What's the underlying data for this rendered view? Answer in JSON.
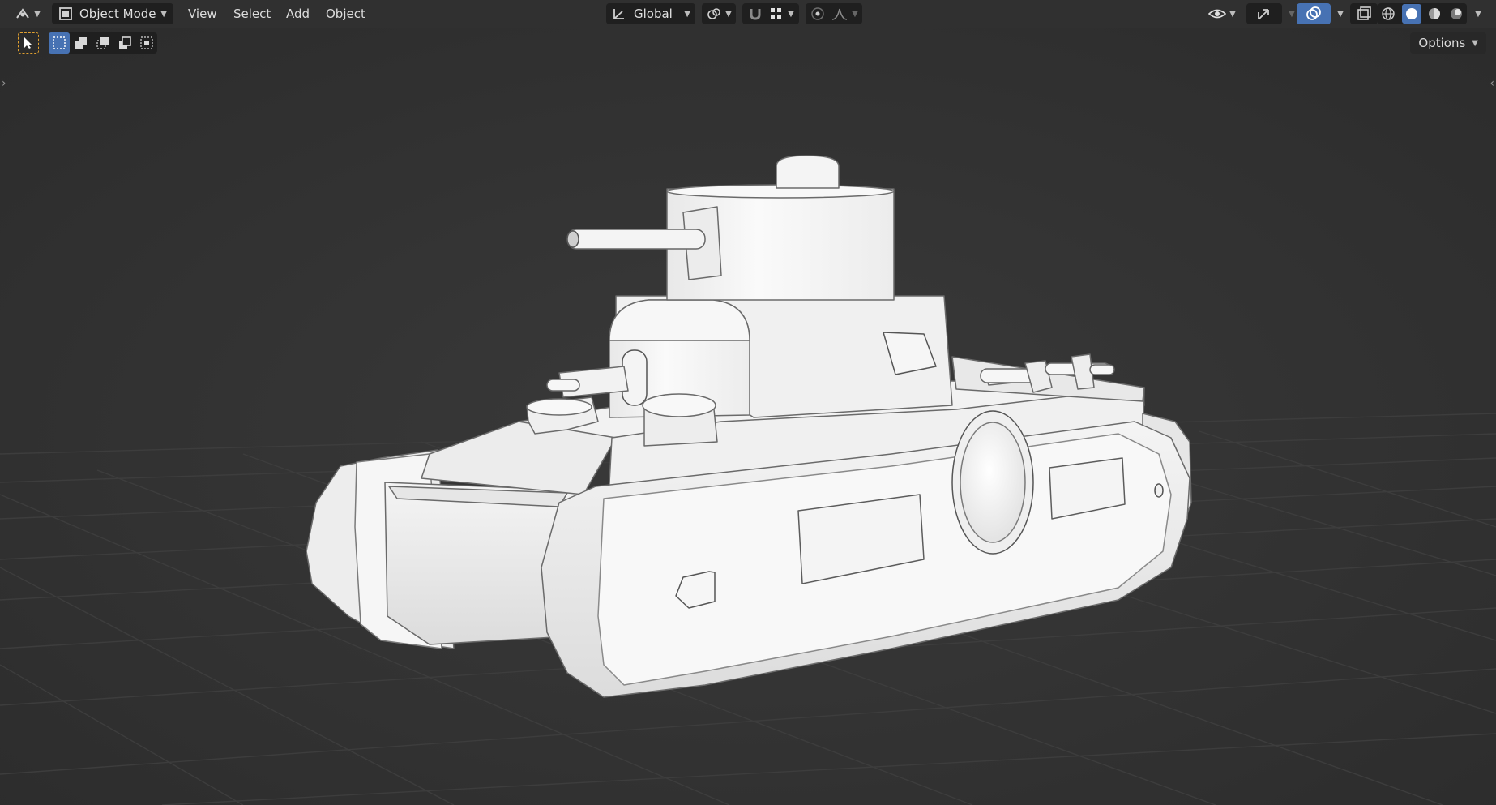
{
  "header": {
    "mode_label": "Object Mode",
    "menus": [
      "View",
      "Select",
      "Add",
      "Object"
    ],
    "transform_orientation": "Global"
  },
  "toolbar2": {
    "options_label": "Options"
  },
  "icons": {
    "editor_type": "editor-type-icon",
    "object_mode": "object-mode-icon",
    "orientation": "transform-orientation-icon",
    "pivot": "pivot-point-icon",
    "snap": "snap-magnet-icon",
    "snap_target": "snap-increment-icon",
    "proportional": "proportional-edit-icon",
    "falloff": "falloff-curve-icon",
    "visibility": "visibility-eye-icon",
    "gizmo": "gizmo-icon",
    "overlays": "overlays-icon",
    "xray": "xray-icon",
    "shading_wire": "wireframe-shading-icon",
    "shading_solid": "solid-shading-icon",
    "shading_material": "material-preview-icon",
    "shading_render": "rendered-shading-icon",
    "tool_select": "select-cursor-icon"
  },
  "colors": {
    "accent": "#4772b3",
    "selected_tool": "#e0a030",
    "background": "#2f2f2f"
  }
}
